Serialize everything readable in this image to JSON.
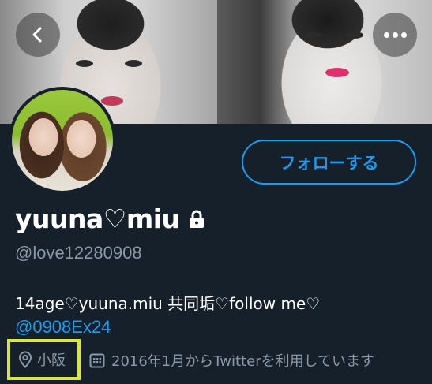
{
  "header": {
    "back_icon": "chevron-left-icon",
    "more_icon": "more-horizontal-icon"
  },
  "profile": {
    "display_name": "yuuna♡miu",
    "protected_icon": "lock-icon",
    "handle": "@love12280908",
    "bio_text": "14age♡yuuna.miu 共同垢♡follow me♡",
    "bio_mention": "@0908Ex24",
    "location": "小阪",
    "location_icon": "location-pin-icon",
    "joined": "2016年1月からTwitterを利用しています",
    "joined_icon": "calendar-icon"
  },
  "actions": {
    "follow_label": "フォローする"
  },
  "colors": {
    "background": "#15202b",
    "accent": "#1d9bf0",
    "secondary_text": "#8b98a5",
    "highlight_box": "#d9e640"
  }
}
